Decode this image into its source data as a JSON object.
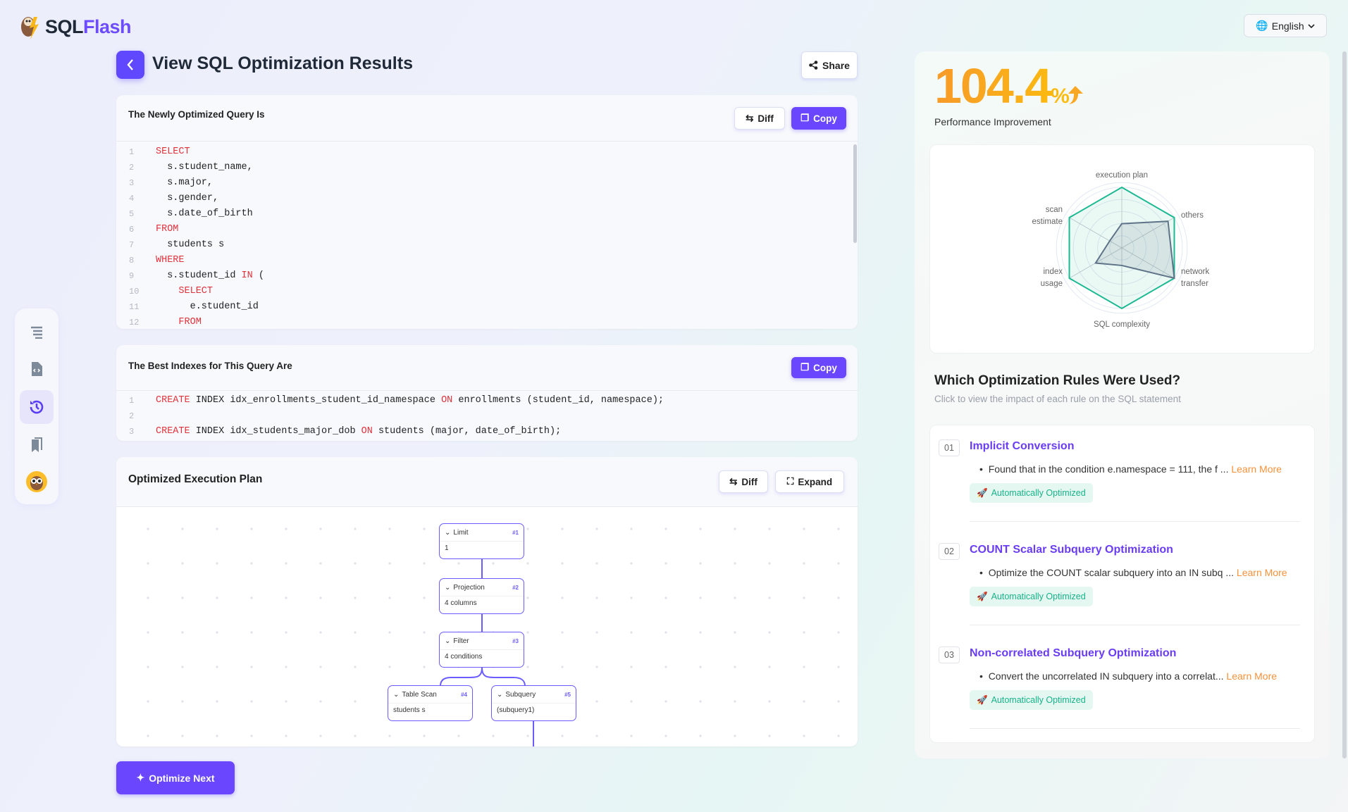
{
  "app": {
    "brand_a": "SQL",
    "brand_b": "Flash",
    "language": "English"
  },
  "header": {
    "title": "View SQL Optimization Results",
    "share": "Share"
  },
  "optimized_query": {
    "title": "The Newly Optimized Query Is",
    "diff": "Diff",
    "copy": "Copy",
    "lines": [
      [
        {
          "t": "SELECT",
          "kw": true
        }
      ],
      [
        {
          "t": "  s.student_name,"
        }
      ],
      [
        {
          "t": "  s.major,"
        }
      ],
      [
        {
          "t": "  s.gender,"
        }
      ],
      [
        {
          "t": "  s.date_of_birth"
        }
      ],
      [
        {
          "t": "FROM",
          "kw": true
        }
      ],
      [
        {
          "t": "  students s"
        }
      ],
      [
        {
          "t": "WHERE",
          "kw": true
        }
      ],
      [
        {
          "t": "  s.student_id "
        },
        {
          "t": "IN",
          "kw": true
        },
        {
          "t": " ("
        }
      ],
      [
        {
          "t": "    "
        },
        {
          "t": "SELECT",
          "kw": true
        }
      ],
      [
        {
          "t": "      e.student_id"
        }
      ],
      [
        {
          "t": "    "
        },
        {
          "t": "FROM",
          "kw": true
        }
      ]
    ]
  },
  "indexes": {
    "title": "The Best Indexes for This Query Are",
    "copy": "Copy",
    "lines": [
      [
        {
          "t": "CREATE",
          "kw": true
        },
        {
          "t": " INDEX idx_enrollments_student_id_namespace "
        },
        {
          "t": "ON",
          "kw": true
        },
        {
          "t": " enrollments (student_id, namespace);"
        }
      ],
      [],
      [
        {
          "t": "CREATE",
          "kw": true
        },
        {
          "t": " INDEX idx_students_major_dob "
        },
        {
          "t": "ON",
          "kw": true
        },
        {
          "t": " students (major, date_of_birth);"
        }
      ]
    ]
  },
  "plan": {
    "title": "Optimized Execution Plan",
    "diff": "Diff",
    "expand": "Expand",
    "nodes": [
      {
        "name": "Limit",
        "id": "#1",
        "detail": "1"
      },
      {
        "name": "Projection",
        "id": "#2",
        "detail": "4 columns"
      },
      {
        "name": "Filter",
        "id": "#3",
        "detail": "4 conditions"
      },
      {
        "name": "Table Scan",
        "id": "#4",
        "detail": "students s"
      },
      {
        "name": "Subquery",
        "id": "#5",
        "detail": "(subquery1)"
      }
    ]
  },
  "optimize_next": "Optimize Next",
  "sidebar": {
    "items": [
      {
        "icon": "menu-icon"
      },
      {
        "icon": "code-file-icon"
      },
      {
        "icon": "history-icon",
        "active": true
      },
      {
        "icon": "bookmarks-icon"
      },
      {
        "icon": "owl-avatar"
      }
    ]
  },
  "performance": {
    "value": "104.4",
    "unit": "%",
    "label": "Performance Improvement",
    "trend": "up"
  },
  "chart_data": {
    "type": "radar",
    "axes": [
      "execution plan",
      "others",
      "network\ntransfer",
      "SQL complexity",
      "index\nusage",
      "scan\nestimate"
    ],
    "series": [
      {
        "values": [
          100,
          100,
          100,
          100,
          100,
          100
        ],
        "color": "#1db992"
      },
      {
        "values": [
          40,
          88,
          100,
          29,
          50,
          23
        ],
        "color": "#5f7388"
      }
    ],
    "range": [
      0,
      100
    ]
  },
  "rules": {
    "title": "Which Optimization Rules Were Used?",
    "subtitle": "Click to view the impact of each rule on the SQL statement",
    "learn_more": "Learn More",
    "items": [
      {
        "num": "01",
        "name": "Implicit Conversion",
        "desc": "Found that in the condition e.namespace = 111, the f ...",
        "badge": "Automatically Optimized"
      },
      {
        "num": "02",
        "name": "COUNT Scalar Subquery Optimization",
        "desc": "Optimize the COUNT scalar subquery into an IN subq ...",
        "badge": "Automatically Optimized"
      },
      {
        "num": "03",
        "name": "Non-correlated Subquery Optimization",
        "desc": "Convert the uncorrelated IN subquery into a correlat...",
        "badge": "Automatically Optimized"
      }
    ]
  },
  "colors": {
    "accent": "#6a47ff",
    "keyword": "#e0323c",
    "success": "#17b389",
    "orange": "#f7a520"
  }
}
